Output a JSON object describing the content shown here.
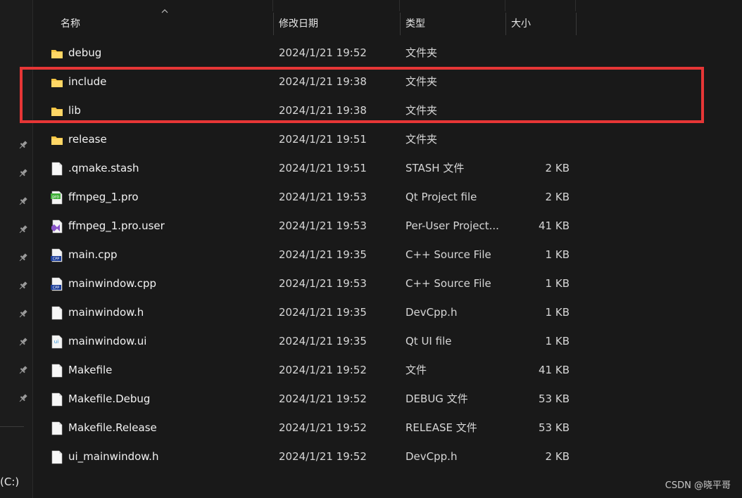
{
  "columns": {
    "name": "名称",
    "date": "修改日期",
    "type": "类型",
    "size": "大小"
  },
  "files": [
    {
      "name": "debug",
      "date": "2024/1/21 19:52",
      "type": "文件夹",
      "size": "",
      "icon": "folder-icon"
    },
    {
      "name": "include",
      "date": "2024/1/21 19:38",
      "type": "文件夹",
      "size": "",
      "icon": "folder-icon"
    },
    {
      "name": "lib",
      "date": "2024/1/21 19:38",
      "type": "文件夹",
      "size": "",
      "icon": "folder-icon"
    },
    {
      "name": "release",
      "date": "2024/1/21 19:51",
      "type": "文件夹",
      "size": "",
      "icon": "folder-icon"
    },
    {
      "name": ".qmake.stash",
      "date": "2024/1/21 19:51",
      "type": "STASH 文件",
      "size": "2 KB",
      "icon": "file-icon"
    },
    {
      "name": "ffmpeg_1.pro",
      "date": "2024/1/21 19:53",
      "type": "Qt Project file",
      "size": "2 KB",
      "icon": "qt-pro-icon"
    },
    {
      "name": "ffmpeg_1.pro.user",
      "date": "2024/1/21 19:53",
      "type": "Per-User Project...",
      "size": "41 KB",
      "icon": "vs-user-icon"
    },
    {
      "name": "main.cpp",
      "date": "2024/1/21 19:35",
      "type": "C++ Source File",
      "size": "1 KB",
      "icon": "cpp-file-icon"
    },
    {
      "name": "mainwindow.cpp",
      "date": "2024/1/21 19:53",
      "type": "C++ Source File",
      "size": "1 KB",
      "icon": "cpp-file-icon"
    },
    {
      "name": "mainwindow.h",
      "date": "2024/1/21 19:35",
      "type": "DevCpp.h",
      "size": "1 KB",
      "icon": "file-icon"
    },
    {
      "name": "mainwindow.ui",
      "date": "2024/1/21 19:35",
      "type": "Qt UI file",
      "size": "1 KB",
      "icon": "qt-ui-icon"
    },
    {
      "name": "Makefile",
      "date": "2024/1/21 19:52",
      "type": "文件",
      "size": "41 KB",
      "icon": "file-icon"
    },
    {
      "name": "Makefile.Debug",
      "date": "2024/1/21 19:52",
      "type": "DEBUG 文件",
      "size": "53 KB",
      "icon": "file-icon"
    },
    {
      "name": "Makefile.Release",
      "date": "2024/1/21 19:52",
      "type": "RELEASE 文件",
      "size": "53 KB",
      "icon": "file-icon"
    },
    {
      "name": "ui_mainwindow.h",
      "date": "2024/1/21 19:52",
      "type": "DevCpp.h",
      "size": "2 KB",
      "icon": "file-icon"
    }
  ],
  "sidebar": {
    "drive_label": "(C:)",
    "pin_count": 10
  },
  "highlight_color": "#e63636",
  "watermark": "CSDN @晓平哥"
}
